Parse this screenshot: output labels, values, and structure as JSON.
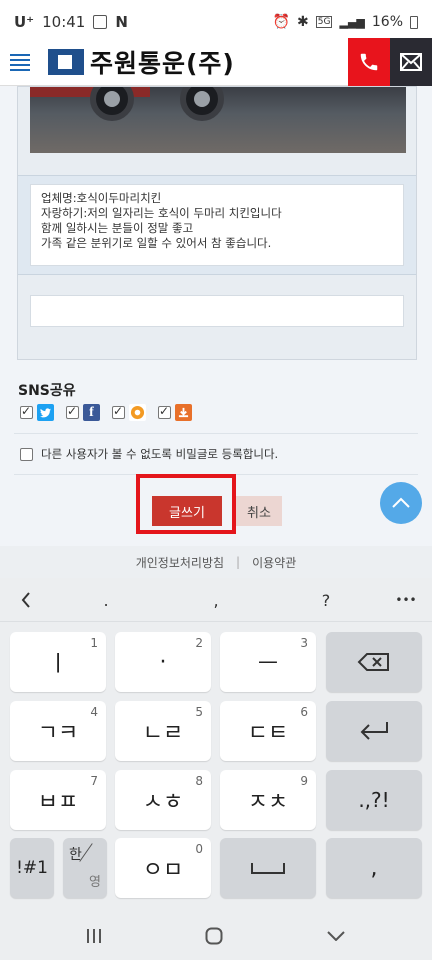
{
  "status_bar": {
    "carrier": "U⁺",
    "time": "10:41",
    "notification_letter": "N",
    "battery": "16%"
  },
  "header": {
    "company_name": "주원통운(주)"
  },
  "post": {
    "text_line1": "업체명:호식이두마리치킨",
    "text_line2": "자랑하기:저의 일자리는 호식이 두마리 치킨입니다",
    "text_line3": "함께 일하시는 분들이 정말 좋고",
    "text_line4": "가족 같은 분위기로 일할 수 있어서 참 좋습니다."
  },
  "sns": {
    "title": "SNS공유",
    "items": [
      {
        "name": "twitter",
        "checked": true,
        "color": "#1da1f2"
      },
      {
        "name": "facebook",
        "checked": true,
        "color": "#3b5998"
      },
      {
        "name": "kakaostory",
        "checked": true,
        "color": "#f39a23"
      },
      {
        "name": "download",
        "checked": true,
        "color": "#e8702a"
      }
    ]
  },
  "secret": {
    "label": "다른 사용자가 볼 수 없도록 비밀글로 등록합니다."
  },
  "buttons": {
    "write_label": "글쓰기",
    "cancel_label": "취소"
  },
  "footer": {
    "privacy_label": "개인정보처리방침",
    "separator": "|",
    "terms_label": "이용약관"
  },
  "keyboard_toolbar": {
    "items": [
      "<",
      ".",
      ",",
      "?",
      "•••"
    ]
  },
  "keyboard": {
    "keys": [
      {
        "label": "ㅣ",
        "num": "1"
      },
      {
        "label": "·",
        "num": "2"
      },
      {
        "label": "ㅡ",
        "num": "3"
      },
      {
        "label": "ㄱㅋ",
        "num": "4"
      },
      {
        "label": "ㄴㄹ",
        "num": "5"
      },
      {
        "label": "ㄷㅌ",
        "num": "6"
      },
      {
        "label": "ㅂㅍ",
        "num": "7"
      },
      {
        "label": "ㅅㅎ",
        "num": "8"
      },
      {
        "label": "ㅈㅊ",
        "num": "9"
      },
      {
        "label": ".,?!"
      },
      {
        "label": "!#1"
      },
      {
        "label": "ㅇㅁ",
        "num": "0"
      },
      {
        "label": ","
      }
    ],
    "lang_top": "한",
    "lang_bottom": "영"
  },
  "colors": {
    "accent_red": "#e8141c",
    "write_button": "#c9362d",
    "scroll_top": "#54a9e8",
    "brand_blue": "#1f4f8c"
  }
}
